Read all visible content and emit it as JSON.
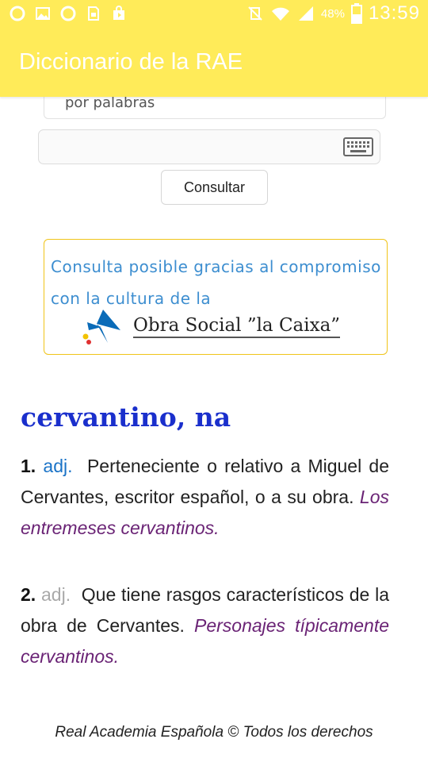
{
  "status_bar": {
    "icons_left": [
      "opera-icon",
      "gallery-icon",
      "opera-icon",
      "document-icon",
      "store-icon"
    ],
    "battery_text": "48%",
    "time": "13:59"
  },
  "app_bar": {
    "title": "Diccionario de la RAE",
    "color": "#ffeb59"
  },
  "search": {
    "mode_value": "por palabras",
    "input_value": "",
    "consult_label": "Consultar"
  },
  "sponsor": {
    "text": "Consulta posible gracias al compromiso con la cultura de la",
    "logo_text": "Obra Social ”la Caixa”"
  },
  "entry": {
    "headword": "cervantino, na",
    "senses": [
      {
        "number": "1.",
        "abbr": "adj.",
        "definition": "Perteneciente o relativo a Miguel de Cervantes, escritor español, o a su obra.",
        "example": "Los entremeses cervantinos."
      },
      {
        "number": "2.",
        "abbr": "adj.",
        "definition": "Que tiene rasgos característicos de la obra de Cervantes.",
        "example": "Personajes típicamente cervantinos."
      }
    ]
  },
  "footer": {
    "text": "Real Academia Española © Todos los derechos"
  }
}
